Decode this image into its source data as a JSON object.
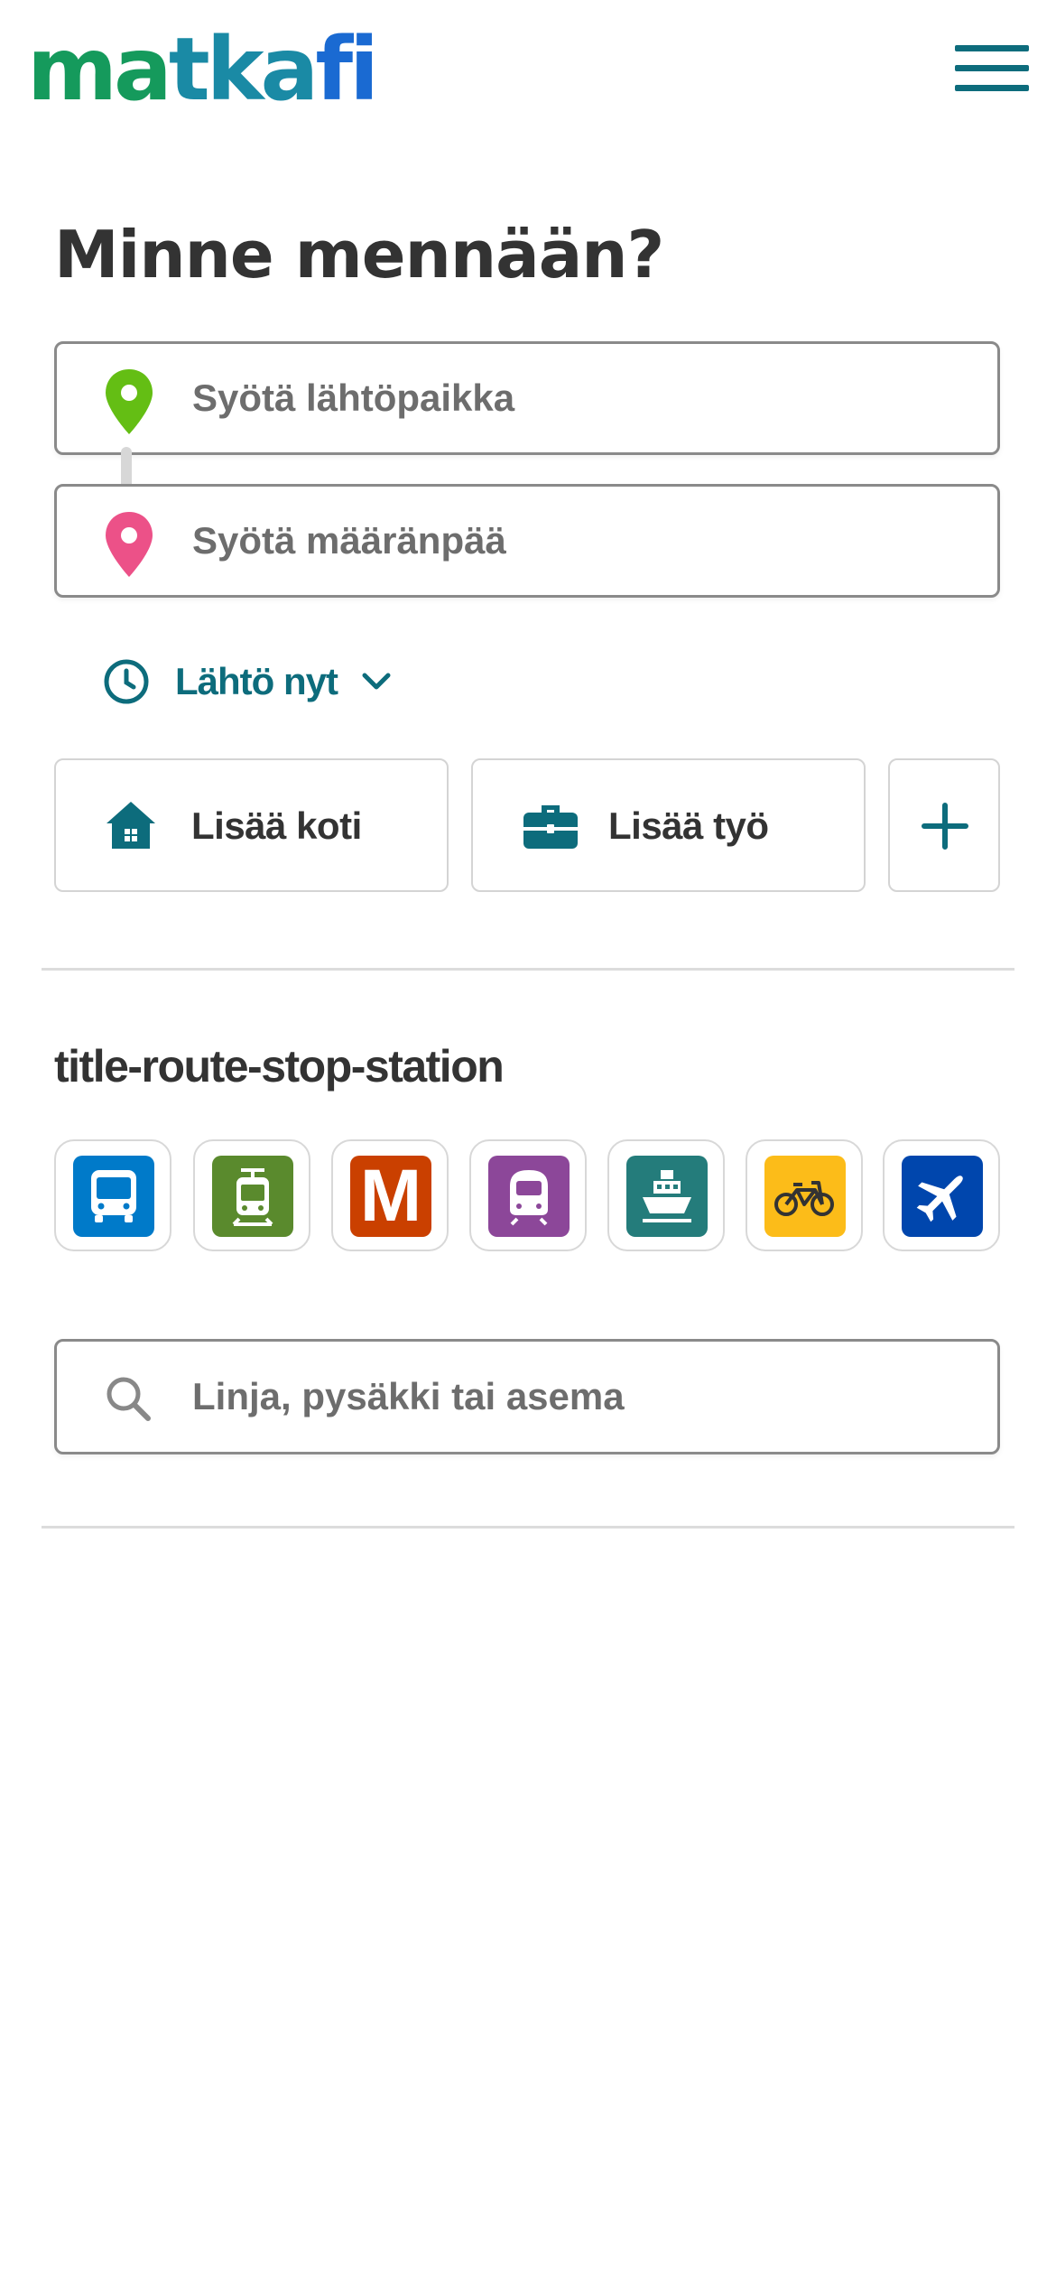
{
  "header": {
    "logo": {
      "part1": "ma",
      "part2": "tka",
      "part3": "fi"
    },
    "menu_icon": "hamburger-menu-icon"
  },
  "main": {
    "title": "Minne mennään?",
    "origin": {
      "placeholder": "Syötä lähtöpaikka",
      "icon": "origin-pin-icon",
      "color": "#64be14"
    },
    "destination": {
      "placeholder": "Syötä määränpää",
      "icon": "destination-pin-icon",
      "color": "#ec5188"
    },
    "time": {
      "label": "Lähtö nyt",
      "icon": "clock-icon",
      "chevron": "chevron-down-icon"
    },
    "favourites": {
      "home": {
        "label": "Lisää koti",
        "icon": "home-icon"
      },
      "work": {
        "label": "Lisää työ",
        "icon": "briefcase-icon"
      },
      "add": {
        "icon": "plus-icon"
      }
    },
    "stops_section": {
      "title": "title-route-stop-station",
      "modes": [
        {
          "name": "bus",
          "icon": "bus-icon",
          "color": "#007ac9"
        },
        {
          "name": "tram",
          "icon": "tram-icon",
          "color": "#5a8a2d"
        },
        {
          "name": "metro",
          "icon": "metro-icon",
          "color": "#ca4000",
          "glyph": "M"
        },
        {
          "name": "rail",
          "icon": "train-icon",
          "color": "#8c4799"
        },
        {
          "name": "ferry",
          "icon": "ferry-icon",
          "color": "#247c7b"
        },
        {
          "name": "citybike",
          "icon": "citybike-icon",
          "color": "#fcbc19"
        },
        {
          "name": "airplane",
          "icon": "airplane-icon",
          "color": "#0046ad"
        }
      ],
      "search": {
        "placeholder": "Linja, pysäkki tai asema",
        "icon": "search-icon"
      }
    }
  },
  "colors": {
    "accent": "#0d6c7c",
    "text": "#333333",
    "placeholder": "#6d6d6d",
    "border": "#8a8a8a"
  }
}
